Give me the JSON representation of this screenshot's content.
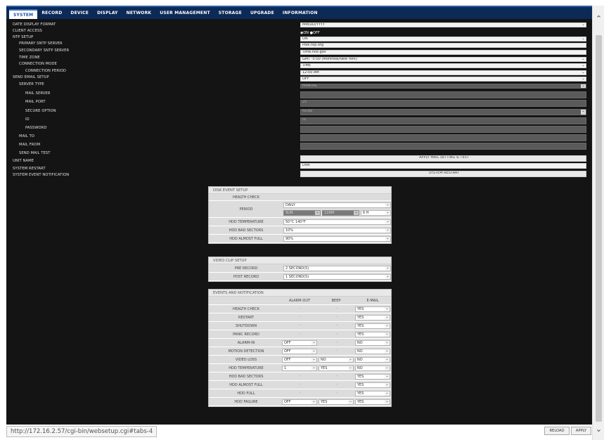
{
  "tabs": [
    {
      "label": "SYSTEM"
    },
    {
      "label": "RECORD"
    },
    {
      "label": "DEVICE"
    },
    {
      "label": "DISPLAY"
    },
    {
      "label": "NETWORK"
    },
    {
      "label": "USER MANAGEMENT"
    },
    {
      "label": "STORAGE"
    },
    {
      "label": "UPGRADE"
    },
    {
      "label": "INFORMATION"
    }
  ],
  "settings": [
    {
      "label": "DATE DISPLAY FORMAT",
      "value": "MM/DD/YYYY"
    },
    {
      "label": "CLIENT ACCESS"
    },
    {
      "label": "NTP SETUP",
      "value": "ON"
    },
    {
      "label": "PRIMARY SNTP SERVER",
      "value": "Pool.ntp.org"
    },
    {
      "label": "SECONDARY SNTP SERVER",
      "value": "Time.nist.gov"
    },
    {
      "label": "TIME ZONE",
      "value": "GMT -5:00 (Montreal/New York)"
    },
    {
      "label": "CONNECTION MODE",
      "value": "TIME"
    },
    {
      "label": "CONNECTION PERIOD",
      "value": "12:00 AM"
    },
    {
      "label": "SEND EMAIL SETUP",
      "value": "OFF"
    },
    {
      "label": "SERVER TYPE",
      "value": "MANUAL"
    },
    {
      "label": "MAIL SERVER",
      "value": ""
    },
    {
      "label": "MAIL PORT",
      "value": "25"
    },
    {
      "label": "SECURE OPTION",
      "value": "NONE"
    },
    {
      "label": "ID",
      "value": "ID"
    },
    {
      "label": "PASSWORD",
      "value": ""
    },
    {
      "label": "MAIL TO",
      "value": ""
    },
    {
      "label": "MAIL FROM",
      "value": ""
    },
    {
      "label": "SEND MAIL TEST",
      "value": "APPLY MAIL SETTING & TEST"
    },
    {
      "label": "UNIT NAME",
      "value": "DVR"
    },
    {
      "label": "SYSTEM RESTART",
      "value": "SYSTEM RESTART"
    },
    {
      "label": "SYSTEM EVENT NOTIFICATION"
    }
  ],
  "client_access": {
    "on": "ON",
    "off": "OFF"
  },
  "disk_event": {
    "title": "DISK EVENT SETUP",
    "health_check": "HEALTH CHECK",
    "period_label": "PERIOD",
    "period_value": "DAILY",
    "period_sub": [
      "SUN",
      "12AM",
      "6 H"
    ],
    "rows": [
      {
        "label": "HDD TEMPERATURE",
        "value": "50°C 140°F"
      },
      {
        "label": "HDD BAD SECTORS",
        "value": "10%"
      },
      {
        "label": "HDD ALMOST FULL",
        "value": "90%"
      }
    ]
  },
  "video_clip": {
    "title": "VIDEO CLIP SETUP",
    "rows": [
      {
        "label": "PRE RECORD",
        "value": "2 SECOND(S)"
      },
      {
        "label": "POST RECORD",
        "value": "1 SECOND(S)"
      }
    ]
  },
  "events": {
    "title": "EVENTS AND NOTIFICATION",
    "cols": [
      "ALARM-OUT",
      "BEEP",
      "E-MAIL"
    ],
    "rows": [
      {
        "label": "HEALTH CHECK",
        "alarm": "-",
        "beep": "-",
        "email": "YES"
      },
      {
        "label": "RESTART",
        "alarm": "-",
        "beep": "-",
        "email": "YES"
      },
      {
        "label": "SHUTDOWN",
        "alarm": "-",
        "beep": "-",
        "email": "YES"
      },
      {
        "label": "PANIC RECORD",
        "alarm": "-",
        "beep": "-",
        "email": "YES"
      },
      {
        "label": "ALARM-IN",
        "alarm": "OFF",
        "beep": "-",
        "email": "NO"
      },
      {
        "label": "MOTION DETECTION",
        "alarm": "OFF",
        "beep": "-",
        "email": "NO"
      },
      {
        "label": "VIDEO LOSS",
        "alarm": "OFF",
        "beep": "NO",
        "email": "NO"
      },
      {
        "label": "HDD TEMPERATURE",
        "alarm": "1",
        "beep": "YES",
        "email": "NO"
      },
      {
        "label": "HDD BAD SECTORS",
        "alarm": "-",
        "beep": "-",
        "email": "YES"
      },
      {
        "label": "HDD ALMOST FULL",
        "alarm": "-",
        "beep": "-",
        "email": "YES"
      },
      {
        "label": "HDD FULL",
        "alarm": "-",
        "beep": "-",
        "email": "YES"
      },
      {
        "label": "HDD FAILURE",
        "alarm": "OFF",
        "beep": "YES",
        "email": "YES"
      }
    ]
  },
  "status_url": "http://172.16.2.57/cgi-bin/websetup.cgi#tabs-4",
  "footer": {
    "reload": "RELOAD",
    "apply": "APPLY"
  },
  "icons": {
    "dropdown": "chevron-down-icon",
    "scroll_up": "chevron-up-icon",
    "scroll_down": "chevron-down-icon"
  },
  "colors": {
    "nav": "#0c2a57",
    "background": "#141414",
    "panel": "#ececec"
  }
}
